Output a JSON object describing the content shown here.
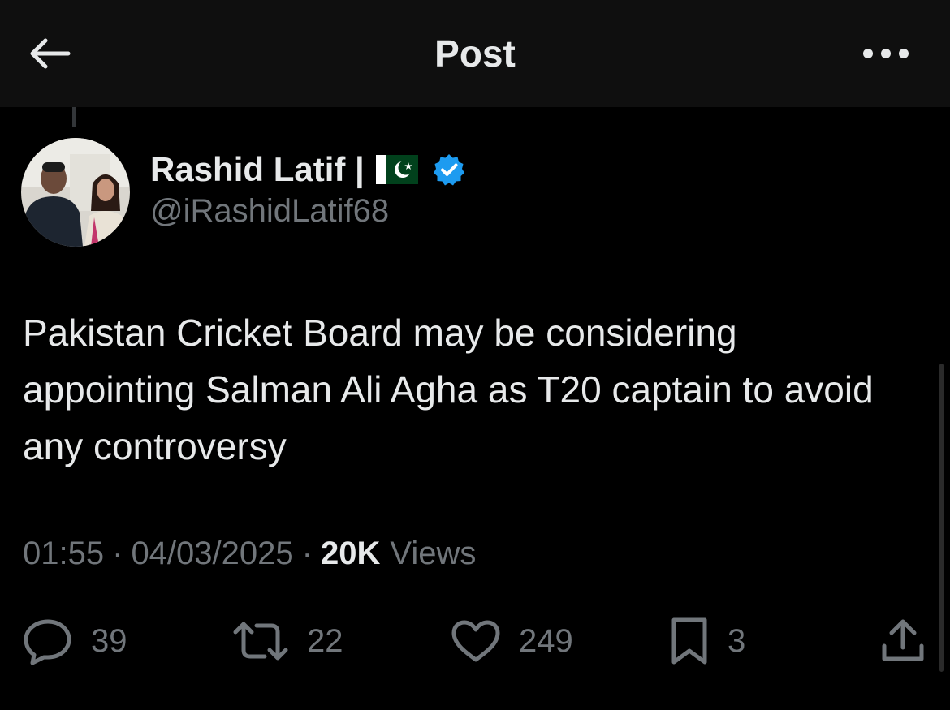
{
  "header": {
    "title": "Post",
    "back_icon": "arrow-left-icon",
    "more_icon": "more-horizontal-icon"
  },
  "author": {
    "name": "Rashid Latif |",
    "handle": "@iRashidLatif68",
    "flag_icon": "pakistan-flag-icon",
    "verified_icon": "verified-badge-icon",
    "verified_color": "#1d9bf0"
  },
  "tweet": {
    "text": "Pakistan Cricket Board may be considering appointing Salman Ali Agha as T20 captain to avoid any controversy"
  },
  "meta": {
    "time": "01:55",
    "separator": "·",
    "date": "04/03/2025",
    "views_count": "20K",
    "views_label": "Views"
  },
  "actions": {
    "replies": "39",
    "reposts": "22",
    "likes": "249",
    "bookmarks": "3"
  },
  "colors": {
    "background": "#000000",
    "primary_text": "#e7e9ea",
    "secondary_text": "#71767b"
  }
}
